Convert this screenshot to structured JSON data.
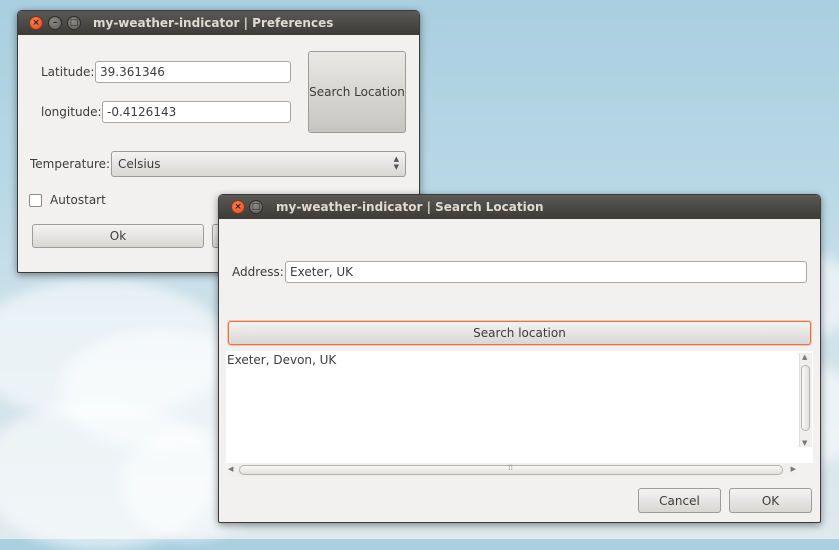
{
  "preferences": {
    "title": "my-weather-indicator | Preferences",
    "latitude_label": "Latitude:",
    "latitude_value": "39.361346",
    "longitude_label": "longitude:",
    "longitude_value": "-0.4126143",
    "search_button": "Search Location",
    "temperature_label": "Temperature:",
    "temperature_value": "Celsius",
    "autostart_label": "Autostart",
    "autostart_checked": false,
    "ok_button": "Ok"
  },
  "search": {
    "title": "my-weather-indicator | Search Location",
    "address_label": "Address:",
    "address_value": "Exeter, UK",
    "search_button": "Search location",
    "results": [
      "Exeter, Devon, UK"
    ],
    "cancel_button": "Cancel",
    "ok_button": "OK"
  },
  "colors": {
    "titlebar": "#3c3b37",
    "close_button": "#df4a16",
    "focus_ring": "#e9733f",
    "window_bg": "#f2f1f0"
  }
}
